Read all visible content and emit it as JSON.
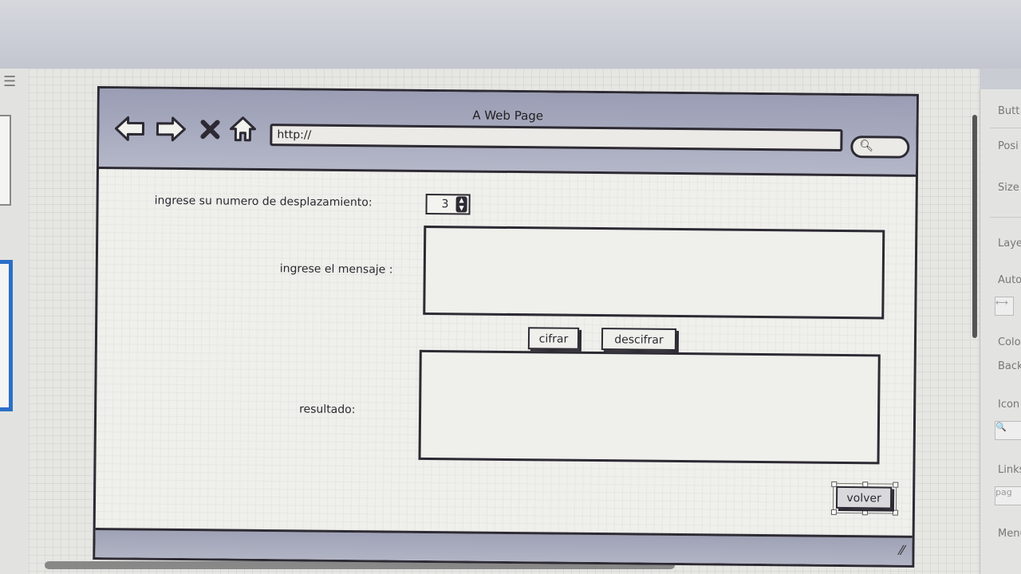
{
  "browser": {
    "title": "A Web Page",
    "url": "http://"
  },
  "form": {
    "shift_label": "ingrese su  numero de desplazamiento:",
    "shift_value": "3",
    "message_label": "ingrese el mensaje :",
    "result_label": "resultado:",
    "encrypt_button": "cifrar",
    "decrypt_button": "descifrar",
    "back_button": "volver"
  },
  "right_panel": {
    "items": [
      "Butt",
      "Posi",
      "Size",
      "Laye",
      "Auto",
      "Colo",
      "Back",
      "Icon",
      "Links",
      "pag",
      "Menu"
    ]
  },
  "icons": {
    "back": "arrow-left-icon",
    "forward": "arrow-right-icon",
    "stop": "close-icon",
    "home": "home-icon",
    "search": "search-icon"
  }
}
